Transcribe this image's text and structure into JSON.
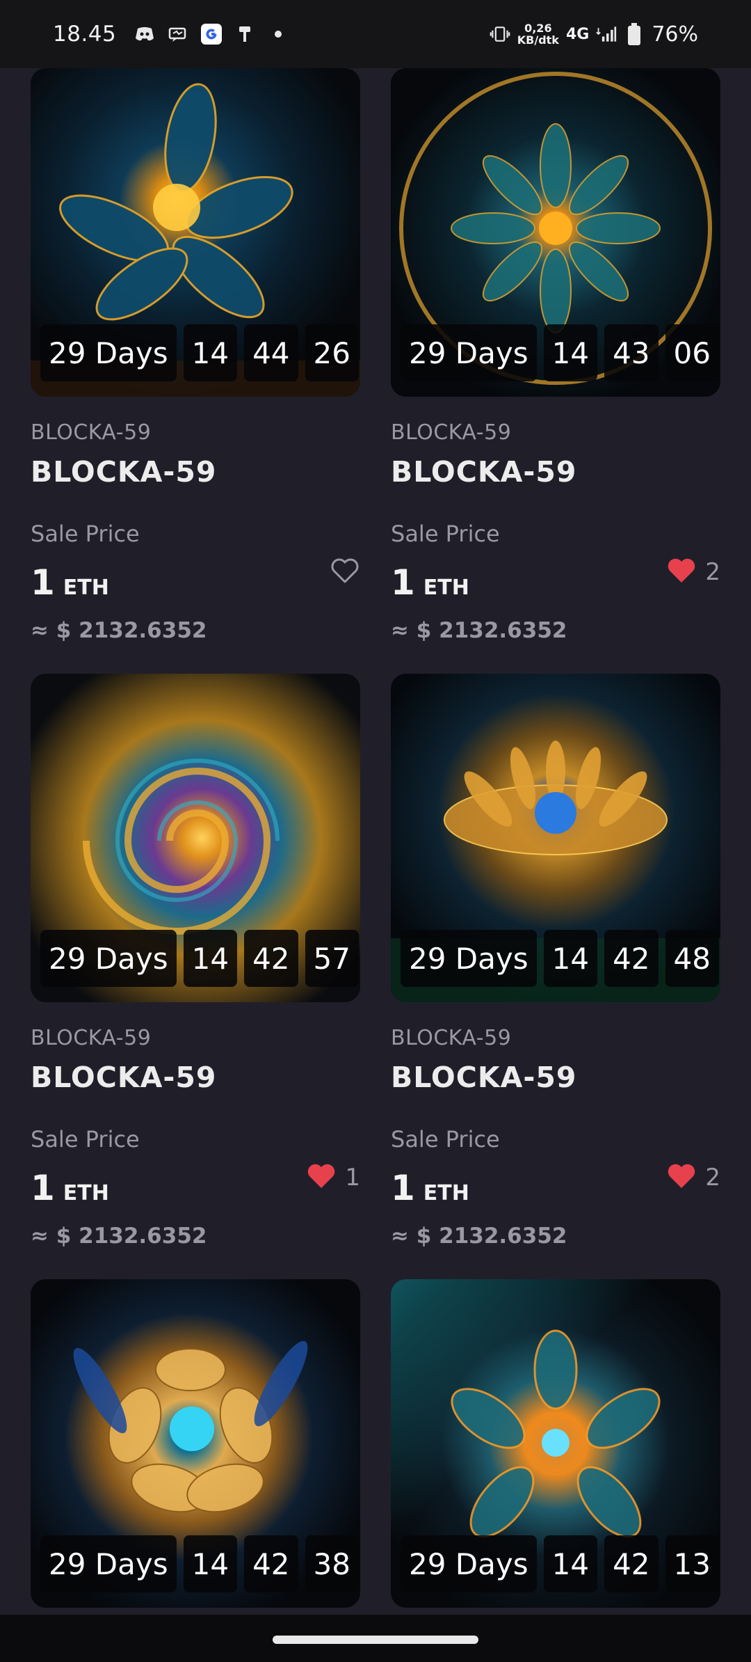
{
  "status_bar": {
    "time": "18.45",
    "net_speed_value": "0,26",
    "net_speed_unit": "KB/dtk",
    "network": "4G",
    "battery": "76%",
    "left_icons": [
      "discord-icon",
      "message-icon",
      "google-icon",
      "paint-icon",
      "dot-icon"
    ]
  },
  "colors": {
    "background": "#201f29",
    "heart_active": "#e8414e",
    "muted_text": "#9a99a3"
  },
  "cards": [
    {
      "collection": "BLOCKA-59",
      "title": "BLOCKA-59",
      "timer": {
        "days": "29 Days",
        "hours": "14",
        "minutes": "44",
        "seconds": "26"
      },
      "sale_label": "Sale Price",
      "price": "1",
      "currency": "ETH",
      "usd": "≈ $ 2132.6352",
      "liked": false,
      "likes": ""
    },
    {
      "collection": "BLOCKA-59",
      "title": "BLOCKA-59",
      "timer": {
        "days": "29 Days",
        "hours": "14",
        "minutes": "43",
        "seconds": "06"
      },
      "sale_label": "Sale Price",
      "price": "1",
      "currency": "ETH",
      "usd": "≈ $ 2132.6352",
      "liked": true,
      "likes": "2"
    },
    {
      "collection": "BLOCKA-59",
      "title": "BLOCKA-59",
      "timer": {
        "days": "29 Days",
        "hours": "14",
        "minutes": "42",
        "seconds": "57"
      },
      "sale_label": "Sale Price",
      "price": "1",
      "currency": "ETH",
      "usd": "≈ $ 2132.6352",
      "liked": true,
      "likes": "1"
    },
    {
      "collection": "BLOCKA-59",
      "title": "BLOCKA-59",
      "timer": {
        "days": "29 Days",
        "hours": "14",
        "minutes": "42",
        "seconds": "48"
      },
      "sale_label": "Sale Price",
      "price": "1",
      "currency": "ETH",
      "usd": "≈ $ 2132.6352",
      "liked": true,
      "likes": "2"
    },
    {
      "collection": "",
      "title": "",
      "timer": {
        "days": "29 Days",
        "hours": "14",
        "minutes": "42",
        "seconds": "38"
      },
      "sale_label": "",
      "price": "",
      "currency": "",
      "usd": "",
      "liked": false,
      "likes": ""
    },
    {
      "collection": "",
      "title": "",
      "timer": {
        "days": "29 Days",
        "hours": "14",
        "minutes": "42",
        "seconds": "13"
      },
      "sale_label": "",
      "price": "",
      "currency": "",
      "usd": "",
      "liked": false,
      "likes": ""
    }
  ]
}
